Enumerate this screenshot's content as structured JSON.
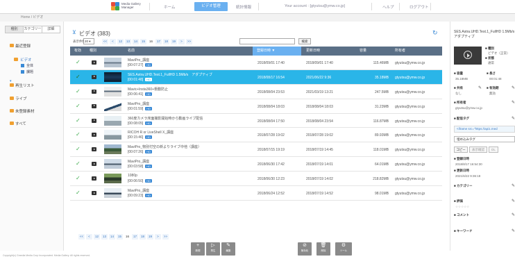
{
  "header": {
    "app_name_line1": "Media Gallery",
    "app_name_line2": "Manager",
    "nav_home": "ホーム",
    "nav_video": "ビデオ管理",
    "nav_stats": "統計情報",
    "account": "Your account : [gtyutsu@ymw.co.jp]",
    "nav_help": "ヘルプ",
    "nav_logout": "ログアウト"
  },
  "breadcrumb": "Home  /  ビデオ",
  "sidebar": {
    "tabs": [
      "種別",
      "カテゴリー",
      "詳細"
    ],
    "items": [
      {
        "label": "最近登録"
      },
      {
        "label": "ビデオ"
      },
      {
        "label": "再生リスト"
      },
      {
        "label": "ライブ"
      },
      {
        "label": "未登録素材"
      },
      {
        "label": "すべて"
      }
    ],
    "subitems": [
      {
        "label": "全体"
      },
      {
        "label": "課題"
      }
    ],
    "colors": {
      "folder": "#f0a030",
      "sub": "#3a8ad6"
    }
  },
  "main": {
    "title": "ビデオ (383)",
    "per_page_label": "表示件数",
    "per_page_value": "20 ▾",
    "search_button": "検索",
    "pager": [
      "<<",
      "<",
      "12",
      "13",
      "14",
      "15",
      "16",
      "17",
      "18",
      "19",
      ">",
      ">>"
    ],
    "pager_current": "16",
    "columns": {
      "status": "有効",
      "type": "種別",
      "name": "名前",
      "created": "登録日時 ▼",
      "updated": "更新日時",
      "size": "容量",
      "owner": "所有者"
    },
    "rows": [
      {
        "title": "MaviPro_講座",
        "duration": "[00:07:27]",
        "created": "2018/09/01 17:40",
        "updated": "2018/09/01 17:40",
        "size": "115.46MB",
        "owner": "gtyutsu@ymw.co.jp",
        "selected": false
      },
      {
        "title": "SES.Astra.UHD.Test.1_FullHD 1.5Mb/s　アダプティブ",
        "duration": "[00:01:48]",
        "created": "2018/08/17 16:54",
        "updated": "2021/06/22 9:36",
        "size": "35.18MB",
        "owner": "gtyutsu@ymw.co.jp",
        "selected": true
      },
      {
        "title": "Mavic+Insta360+衝動防止",
        "duration": "[00:06:41]",
        "created": "2018/08/04 23:53",
        "updated": "2021/03/19 13:21",
        "size": "247.5MB",
        "owner": "gtyutsu@ymw.co.jp",
        "selected": false
      },
      {
        "title": "MaviPro_講座",
        "duration": "[00:01:59]",
        "created": "2018/08/04 18:03",
        "updated": "2018/08/04 18:03",
        "size": "31.23MB",
        "owner": "gtyutsu@ymw.co.jp",
        "selected": false
      },
      {
        "title": "360度カメラ床面撮影開始時から動画ライブ配信",
        "duration": "[00:08:05]",
        "created": "2018/08/04 17:50",
        "updated": "2018/08/04 23:54",
        "size": "116.87MB",
        "owner": "gtyutsu@ymw.co.jp",
        "selected": false
      },
      {
        "title": "RICOH R or LiveShell X_講座",
        "duration": "[00:15:46]",
        "created": "2018/07/28 19:02",
        "updated": "2018/07/28 19:02",
        "size": "89.93MB",
        "owner": "gtyutsu@ymw.co.jp",
        "selected": false
      },
      {
        "title": "MaviPro_物別付空の新よりライブ中他（講座）",
        "duration": "[00:07:26]",
        "created": "2018/07/15 19:19",
        "updated": "2018/07/19 14:45",
        "size": "118.01MB",
        "owner": "gtyutsu@ymw.co.jp",
        "selected": false
      },
      {
        "title": "MaviPro_講座",
        "duration": "[00:03:58]",
        "created": "2018/06/30 17:42",
        "updated": "2018/07/19 14:01",
        "size": "64.01MB",
        "owner": "gtyutsu@ymw.co.jp",
        "selected": false
      },
      {
        "title": "1080p",
        "duration": "[00:06:50]",
        "created": "2018/06/30 12:23",
        "updated": "2018/07/19 14:02",
        "size": "218.82MB",
        "owner": "gtyutsu@ymw.co.jp",
        "selected": false
      },
      {
        "title": "MaviPro_講座",
        "duration": "[00:09:23]",
        "created": "2018/06/24 12:52",
        "updated": "2018/07/19 14:52",
        "size": "98.01MB",
        "owner": "gtyutsu@ymw.co.jp",
        "selected": false
      }
    ],
    "hd_badge": "HD",
    "bottom_pager": [
      "<<",
      "<",
      "12",
      "13",
      "14",
      "15",
      "16",
      "17",
      "18",
      "19",
      ">",
      ">>"
    ]
  },
  "actions": [
    {
      "label": "新規",
      "icon": "plus-icon"
    },
    {
      "label": "再生",
      "icon": "play-icon"
    },
    {
      "label": "編集",
      "icon": "edit-icon"
    },
    {
      "label": "無効化",
      "icon": "block-icon"
    },
    {
      "label": "削除",
      "icon": "trash-icon"
    },
    {
      "label": "ツール",
      "icon": "gear-icon"
    }
  ],
  "copyright": "Copyright(c) Gmedia Media Corp Incorporated. Media Gallery. All rights reserved.",
  "rpanel": {
    "title": "SES.Astra.UHD.Test.1_FullHD 1.5Mb/s　アダプティブ",
    "type_label": "■ 種別",
    "type_value": "ビデオ（正常）",
    "status_label": "■ 状態",
    "status_value": "通常",
    "size_label": "■ 容量",
    "size_value": "35.18MB",
    "duration_label": "■ 長さ",
    "duration_value": "00:01:48",
    "use_label": "■ 共有",
    "use_value": "なし",
    "valid_label": "■ 有効期",
    "valid_value": "無効",
    "owner_label": "■ 所有者",
    "owner_value": "gtyutsu@ymw.co.jp",
    "embed_label": "■ 配信タグ",
    "embed_value": "<iframe src=\"https://api1.med",
    "select_value": "埋め込みタグ",
    "copy_button": "コピー",
    "preview_button": "表示確認",
    "download_button": "DL",
    "created_label": "■ 登録日時",
    "created_value": "2018/8/17 16:54:30",
    "updated_label": "■ 更新日時",
    "updated_value": "2021/6/22 9:36:18",
    "category_label": "■ カテゴリー",
    "rating_label": "■ 評価",
    "rating_value": "☆☆☆☆☆",
    "comment_label": "■ コメント",
    "keyword_label": "■ キーワード"
  },
  "colors": {
    "accent": "#3a8ad6",
    "selected_row": "#2ab5e8",
    "table_header": "#5a6f86",
    "check": "#3daa4c"
  }
}
